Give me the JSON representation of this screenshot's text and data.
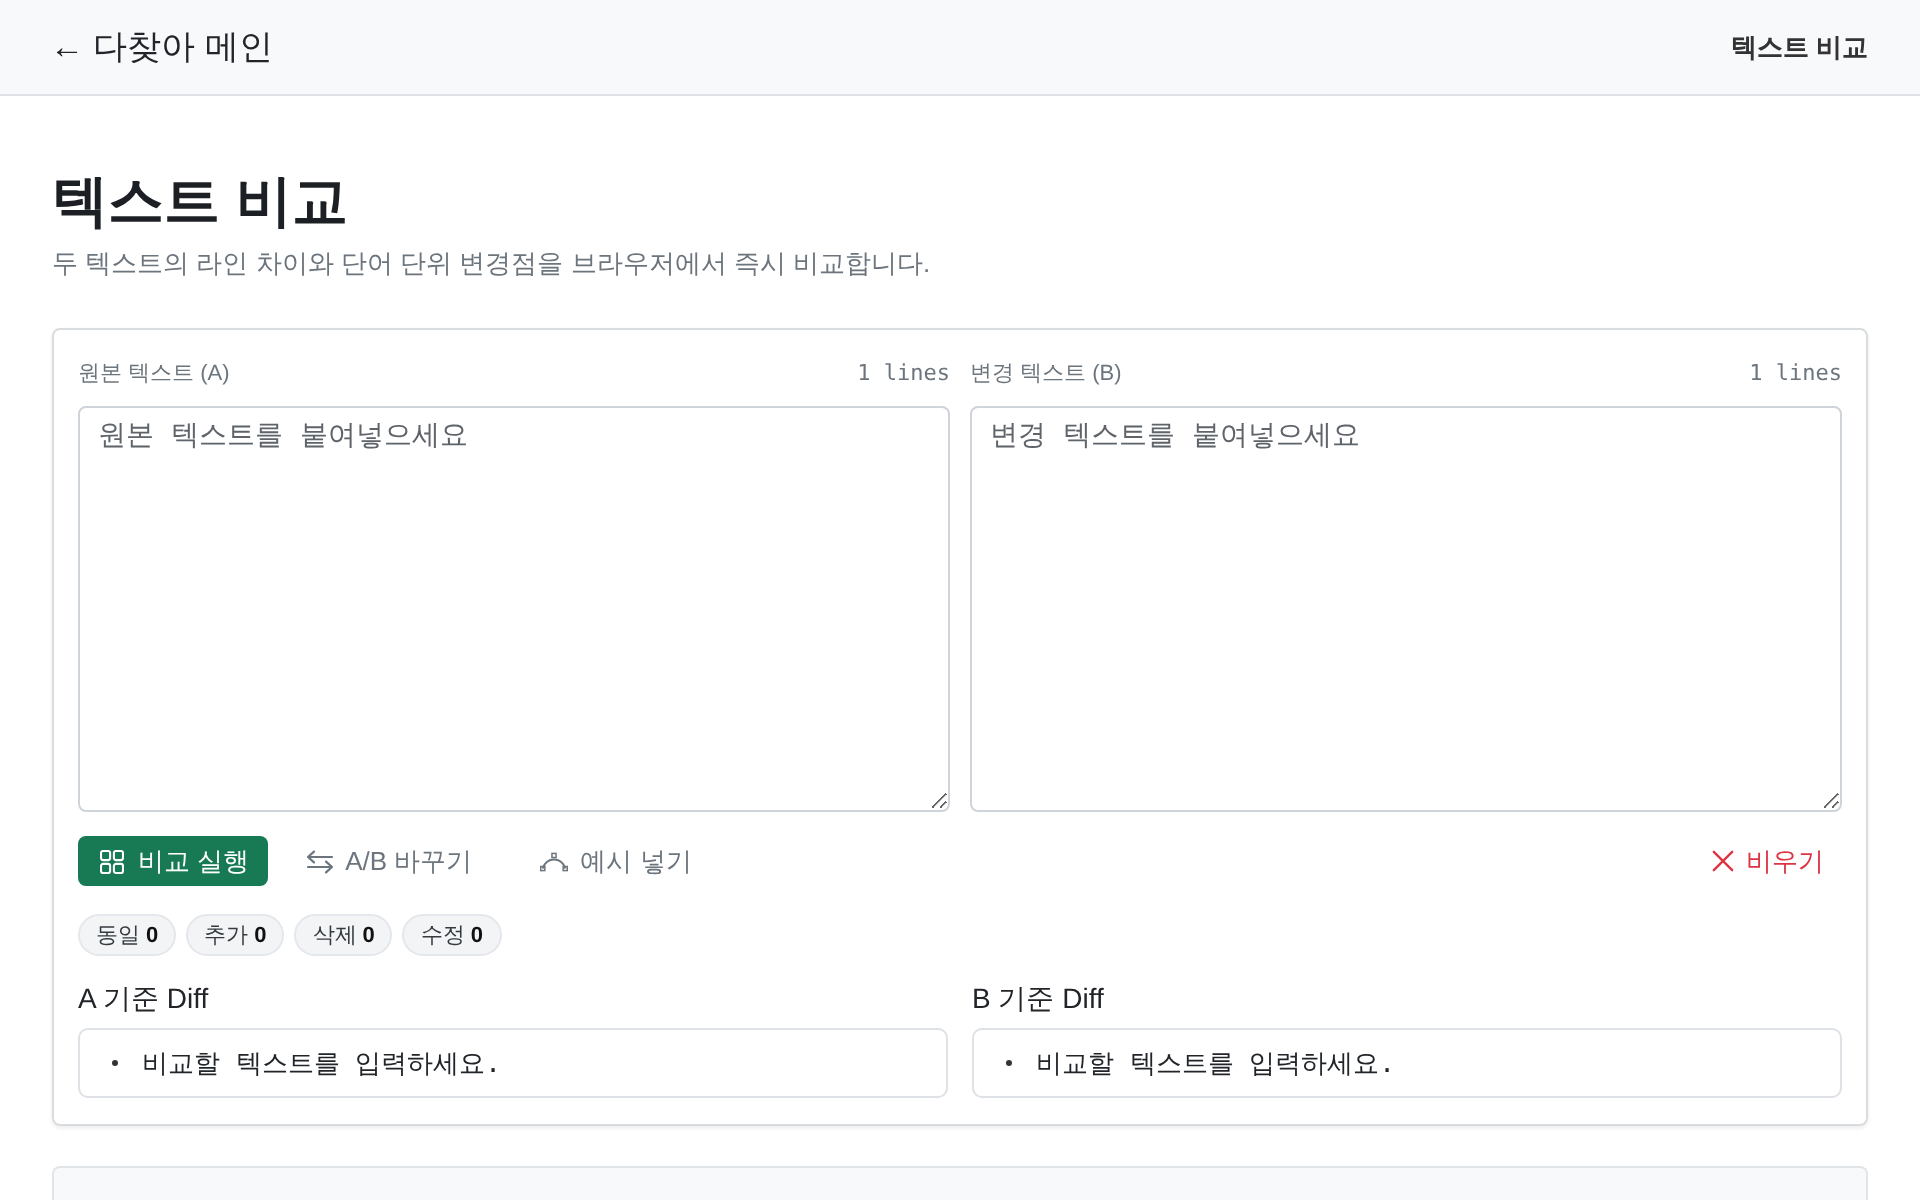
{
  "header": {
    "back_link": "← 다찾아 메인",
    "current_page": "텍스트 비교"
  },
  "page": {
    "title": "텍스트 비교",
    "subtitle": "두 텍스트의 라인 차이와 단어 단위 변경점을 브라우저에서 즉시 비교합니다."
  },
  "editors": [
    {
      "label": "원본 텍스트 (A)",
      "line_count": "1 lines",
      "placeholder": "원본 텍스트를 붙여넣으세요"
    },
    {
      "label": "변경 텍스트 (B)",
      "line_count": "1 lines",
      "placeholder": "변경 텍스트를 붙여넣으세요"
    }
  ],
  "actions": [
    {
      "kind": "run",
      "label": "비교 실행"
    },
    {
      "kind": "swap",
      "label": "A/B 바꾸기"
    },
    {
      "kind": "sample",
      "label": "예시 넣기"
    },
    {
      "kind": "clear",
      "label": "비우기"
    }
  ],
  "stats": [
    {
      "label": "동일",
      "count": "0"
    },
    {
      "label": "추가",
      "count": "0"
    },
    {
      "label": "삭제",
      "count": "0"
    },
    {
      "label": "수정",
      "count": "0"
    }
  ],
  "diffs": [
    {
      "title": "A 기준 Diff",
      "message": "비교할 텍스트를 입력하세요."
    },
    {
      "title": "B 기준 Diff",
      "message": "비교할 텍스트를 입력하세요."
    }
  ]
}
